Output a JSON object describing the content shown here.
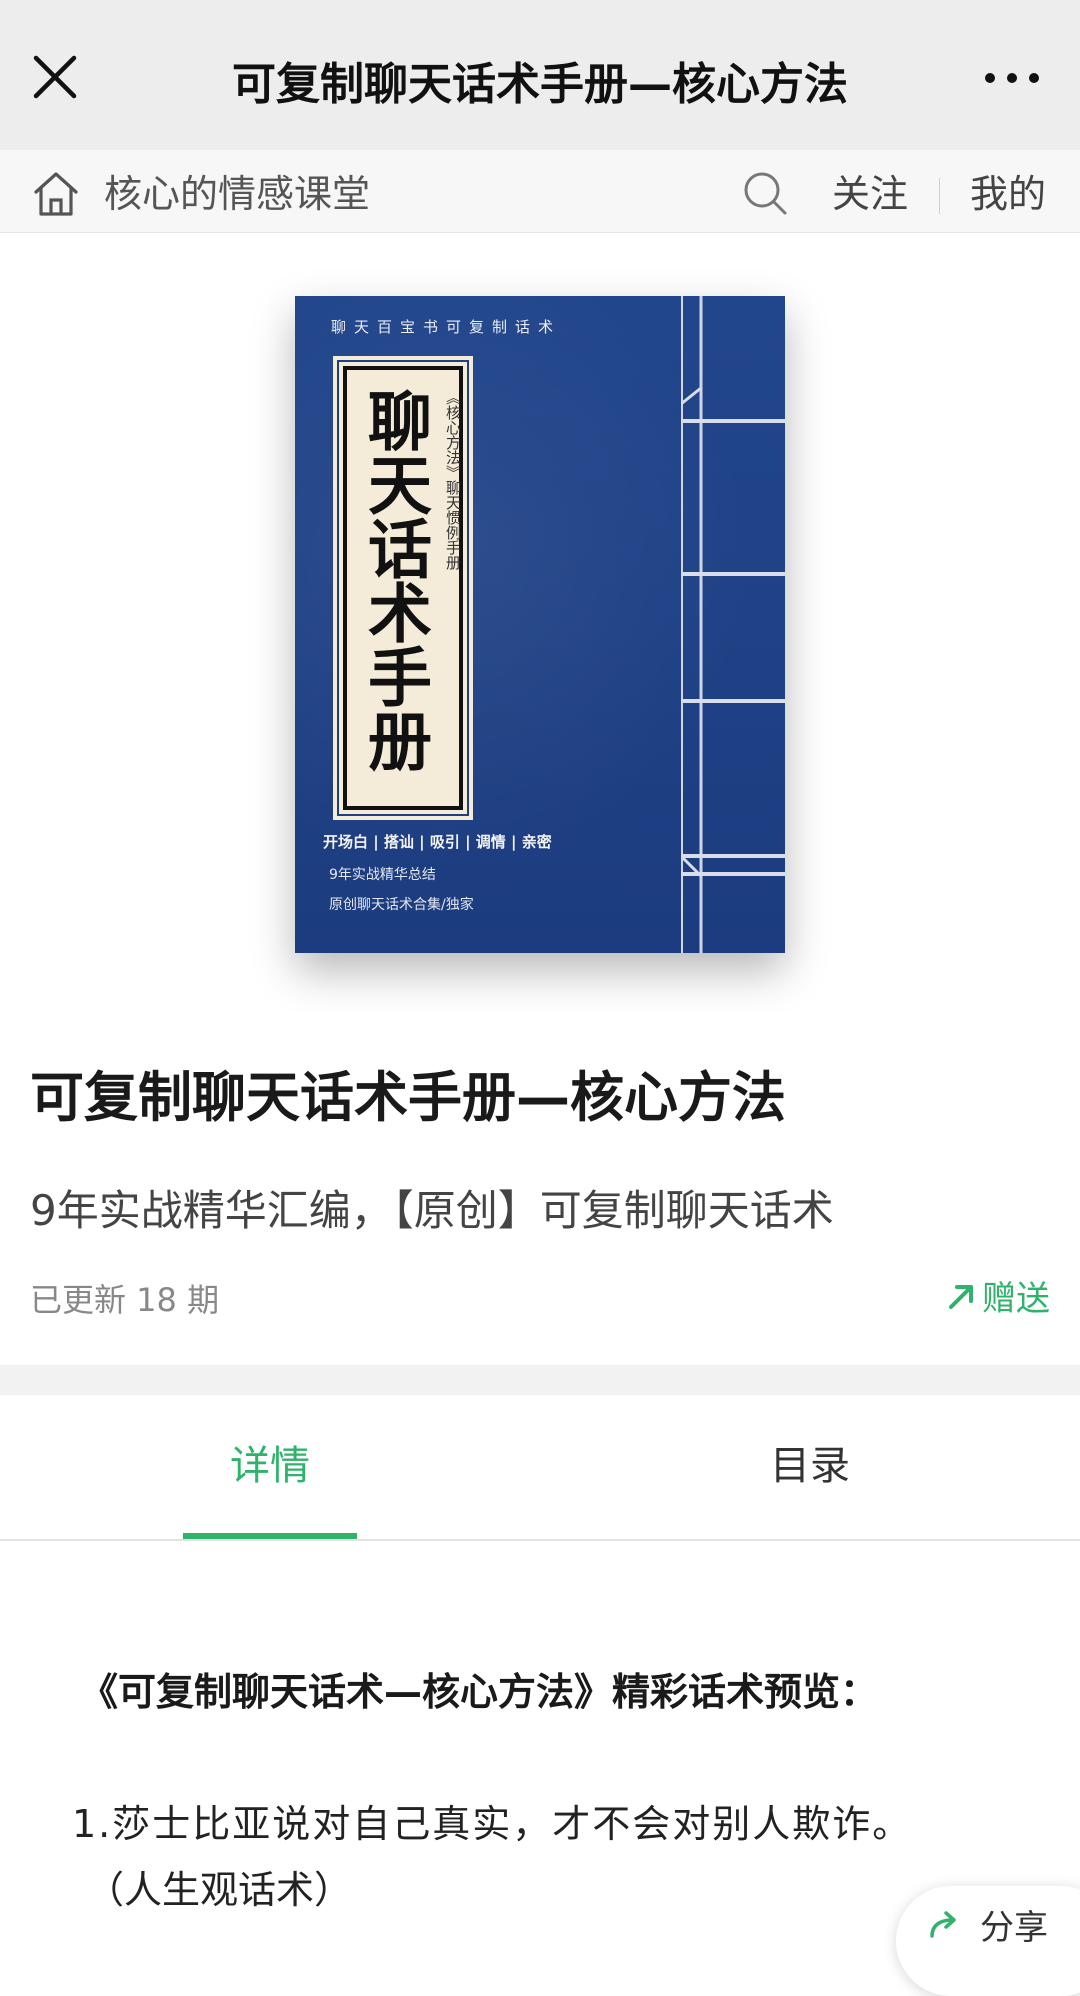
{
  "topbar": {
    "title": "可复制聊天话术手册—核心方法"
  },
  "subbar": {
    "channel": "核心的情感课堂",
    "follow_label": "关注",
    "mine_label": "我的"
  },
  "cover": {
    "series": "聊天百宝书可复制话术",
    "main_title": "聊天话术手册",
    "side_text": "《核心方法》聊天惯例手册",
    "tags": "开场白 | 搭讪 | 吸引 | 调情 | 亲密",
    "line1": "9年实战精华总结",
    "line2": "原创聊天话术合集/独家",
    "colors": {
      "cover": "#1d3f83",
      "label": "#f4ecd8"
    }
  },
  "info": {
    "title": "可复制聊天话术手册—核心方法",
    "subtitle": "9年实战精华汇编，【原创】可复制聊天话术",
    "updated": "已更新 18 期",
    "gift_label": "赠送"
  },
  "tabs": [
    {
      "label": "详情",
      "active": true
    },
    {
      "label": "目录",
      "active": false
    }
  ],
  "article": {
    "heading": "《可复制聊天话术—核心方法》精彩话术预览：",
    "item1": "1.莎士比亚说对自己真实，才不会对别人欺诈。",
    "item1_note": "（人生观话术）"
  },
  "share": {
    "label": "分享"
  },
  "accent_color": "#2fb36a",
  "icons": [
    "close-icon",
    "more-icon",
    "home-icon",
    "search-icon",
    "gift-arrow-icon",
    "share-icon"
  ]
}
